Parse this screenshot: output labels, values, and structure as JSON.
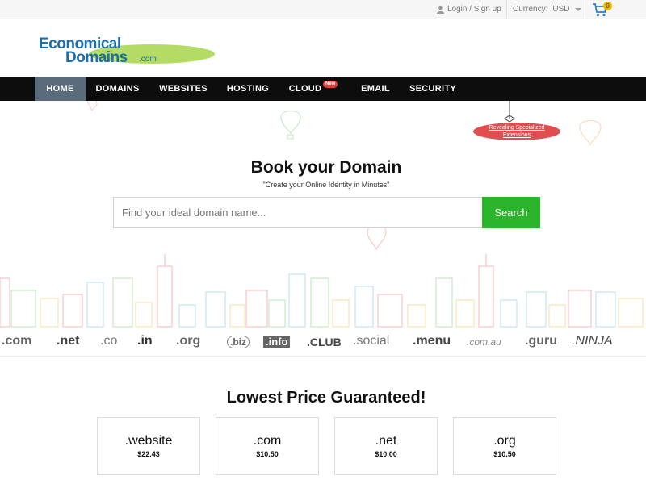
{
  "topbar": {
    "login_label": "Login / Sign up",
    "currency_label": "Currency:",
    "currency_value": "USD",
    "cart_count": "0"
  },
  "logo": {
    "line1": "Economical",
    "line2": "Domains",
    "suffix": ".com"
  },
  "nav": {
    "items": [
      {
        "label": "HOME"
      },
      {
        "label": "DOMAINS"
      },
      {
        "label": "WEBSITES"
      },
      {
        "label": "HOSTING"
      },
      {
        "label": "CLOUD"
      },
      {
        "label": "EMAIL"
      },
      {
        "label": "SECURITY"
      }
    ],
    "new_badge": "New"
  },
  "hero": {
    "ribbon_line1": "Revealing Specialized",
    "ribbon_line2": "Extensions",
    "title": "Book your Domain",
    "subtitle": "\"Create your Online Identity in Minutes\"",
    "search_placeholder": "Find your ideal domain name...",
    "search_button": "Search"
  },
  "tlds": [
    ".com",
    ".net",
    ".co",
    ".in",
    ".org",
    ".biz",
    ".info",
    ".CLUB",
    ".social",
    ".menu",
    ".com.au",
    ".guru",
    ".NINJA"
  ],
  "pricing": {
    "title": "Lowest Price Guaranteed!",
    "cards": [
      {
        "ext": ".website",
        "price": "$22.43"
      },
      {
        "ext": ".com",
        "price": "$10.50"
      },
      {
        "ext": ".net",
        "price": "$10.00"
      },
      {
        "ext": ".org",
        "price": "$10.50"
      }
    ]
  },
  "colors": {
    "accent_green": "#2ab52a",
    "nav_bg": "#0d0d0d",
    "nav_active": "#5a6b7b",
    "brand_blue": "#1a6faf",
    "ribbon_red": "#e04f4f"
  }
}
